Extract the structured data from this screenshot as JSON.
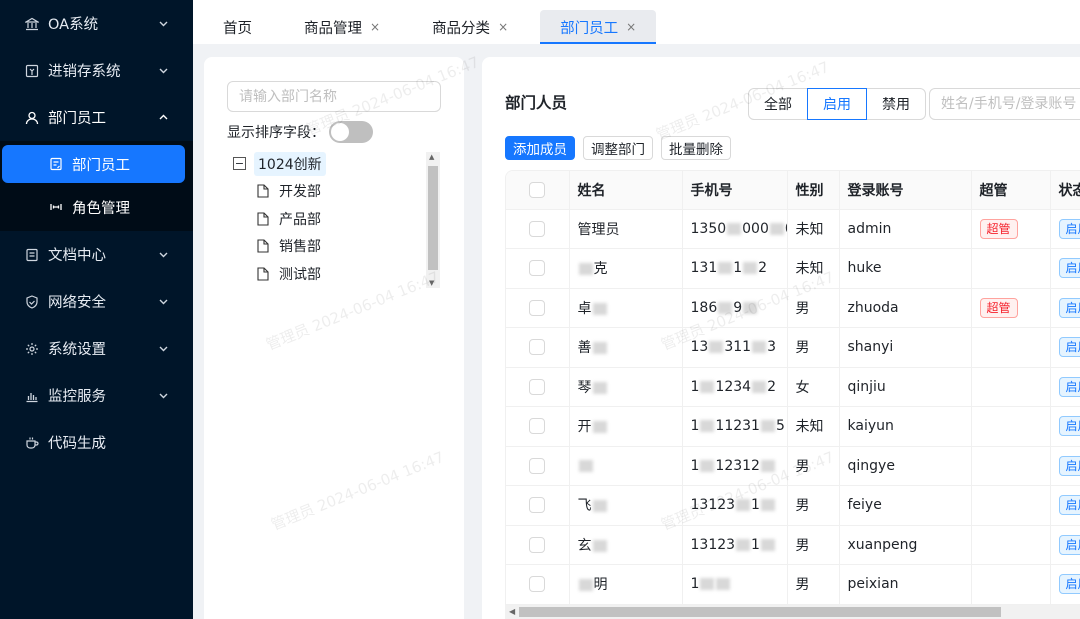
{
  "sidebar": {
    "items": [
      {
        "label": "OA系统",
        "icon": "bank-icon",
        "arrow": "down"
      },
      {
        "label": "进销存系统",
        "icon": "warehouse-icon",
        "arrow": "down"
      },
      {
        "label": "部门员工",
        "icon": "user-icon",
        "arrow": "up"
      },
      {
        "label": "文档中心",
        "icon": "document-icon",
        "arrow": "down"
      },
      {
        "label": "网络安全",
        "icon": "shield-icon",
        "arrow": "down"
      },
      {
        "label": "系统设置",
        "icon": "gear-icon",
        "arrow": "down"
      },
      {
        "label": "监控服务",
        "icon": "bar-chart-icon",
        "arrow": "down"
      },
      {
        "label": "代码生成",
        "icon": "code-cup-icon",
        "arrow": ""
      }
    ],
    "submenu": [
      {
        "label": "部门员工",
        "icon": "id-card-icon",
        "active": true
      },
      {
        "label": "角色管理",
        "icon": "role-icon",
        "active": false
      }
    ]
  },
  "tabs": [
    {
      "label": "首页",
      "closable": false
    },
    {
      "label": "商品管理",
      "closable": true
    },
    {
      "label": "商品分类",
      "closable": true
    },
    {
      "label": "部门员工",
      "closable": true,
      "active": true
    }
  ],
  "tab_close_glyph": "×",
  "tree_panel": {
    "search_placeholder": "请输入部门名称",
    "sort_label": "显示排序字段：",
    "sort_enabled": false,
    "root": {
      "toggle": "⊟",
      "label": "1024创新"
    },
    "children": [
      "开发部",
      "产品部",
      "销售部",
      "测试部"
    ]
  },
  "main": {
    "title": "部门人员",
    "filters": [
      "全部",
      "启用",
      "禁用"
    ],
    "active_filter": "启用",
    "search_placeholder": "姓名/手机号/登录账号",
    "actions": [
      "添加成员",
      "调整部门",
      "批量删除"
    ],
    "columns": [
      "姓名",
      "手机号",
      "性别",
      "登录账号",
      "超管",
      "状态"
    ],
    "rows": [
      {
        "name": "管理员",
        "phone": "1350",
        "phone_tail": "000",
        "phone_end": "0",
        "gender": "未知",
        "account": "admin",
        "super": "超管",
        "status": "启用"
      },
      {
        "name": "",
        "name_tail": "克",
        "phone": "131",
        "phone_tail": "1",
        "phone_end": "2",
        "gender": "未知",
        "account": "huke",
        "super": "",
        "status": "启用"
      },
      {
        "name": "卓",
        "name_tail": "",
        "phone": "186",
        "phone_tail": "9",
        "phone_end": "",
        "gender": "男",
        "account": "zhuoda",
        "super": "超管",
        "status": "启用"
      },
      {
        "name": "善",
        "name_tail": "",
        "phone": "13",
        "phone_tail": "311",
        "phone_end": "3",
        "gender": "男",
        "account": "shanyi",
        "super": "",
        "status": "启用"
      },
      {
        "name": "琴",
        "name_tail": "",
        "phone": "1",
        "phone_tail": "1234",
        "phone_end": "2",
        "gender": "女",
        "account": "qinjiu",
        "super": "",
        "status": "启用"
      },
      {
        "name": "开",
        "name_tail": "",
        "phone": "1",
        "phone_tail": "11231",
        "phone_end": "5",
        "gender": "未知",
        "account": "kaiyun",
        "super": "",
        "status": "启用"
      },
      {
        "name": "",
        "name_tail": "",
        "phone": "1",
        "phone_tail": "12312",
        "phone_end": "",
        "gender": "男",
        "account": "qingye",
        "super": "",
        "status": "启用"
      },
      {
        "name": "飞",
        "name_tail": "",
        "phone": "13123",
        "phone_tail": "1",
        "phone_end": "",
        "gender": "男",
        "account": "feiye",
        "super": "",
        "status": "启用"
      },
      {
        "name": "玄",
        "name_tail": "",
        "phone": "13123",
        "phone_tail": "1",
        "phone_end": "",
        "gender": "男",
        "account": "xuanpeng",
        "super": "",
        "status": "启用"
      },
      {
        "name": "",
        "name_tail": "明",
        "phone": "1",
        "phone_tail": "",
        "phone_end": "",
        "gender": "男",
        "account": "peixian",
        "super": "",
        "status": "启用"
      }
    ]
  },
  "watermark_text": "管理员 2024-06-04 16:47",
  "colors": {
    "sidebar_bg": "#001529",
    "accent": "#1677ff",
    "danger": "#f5222d"
  }
}
